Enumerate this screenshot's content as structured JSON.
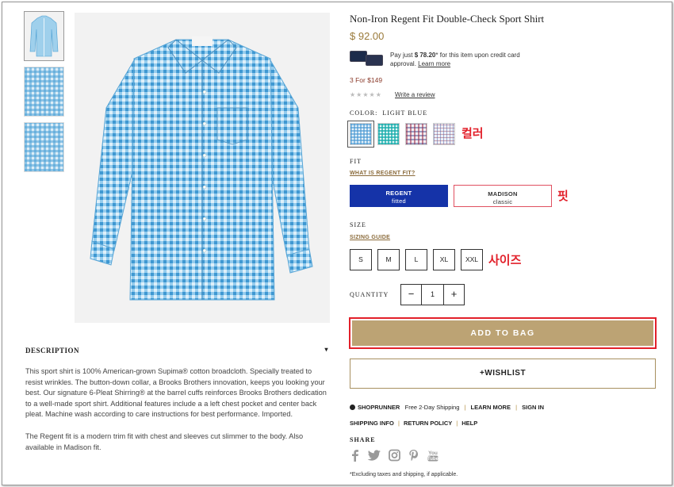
{
  "product": {
    "title": "Non-Iron Regent Fit Double-Check Sport Shirt",
    "price": "$ 92.00",
    "financing_text_1": "Pay just ",
    "financing_amount": "$ 78.20",
    "financing_text_2": "* for this item upon credit card approval. ",
    "financing_link": "Learn more",
    "promo": "3 For $149",
    "rating_stars": "★★★★★",
    "write_review": "Write a review"
  },
  "color": {
    "label": "COLOR:",
    "selected": "LIGHT BLUE",
    "annotation": "컬러"
  },
  "fit": {
    "label": "FIT",
    "guide_link": "WHAT IS REGENT FIT?",
    "options": [
      {
        "name": "REGENT",
        "sub": "fitted"
      },
      {
        "name": "MADISON",
        "sub": "classic"
      }
    ],
    "annotation": "핏"
  },
  "size": {
    "label": "SIZE",
    "guide_link": "SIZING GUIDE",
    "options": [
      "S",
      "M",
      "L",
      "XL",
      "XXL"
    ],
    "annotation": "사이즈"
  },
  "quantity": {
    "label": "QUANTITY",
    "value": "1",
    "minus": "−",
    "plus": "+"
  },
  "actions": {
    "add_to_bag": "ADD TO BAG",
    "wishlist": "+WISHLIST"
  },
  "shipping": {
    "shoprunner": "SHOPRUNNER",
    "free_shipping": "Free 2-Day Shipping",
    "learn_more": "LEARN MORE",
    "sign_in": "SIGN IN",
    "shipping_info": "SHIPPING INFO",
    "return_policy": "RETURN POLICY",
    "help": "HELP",
    "separator": "|"
  },
  "share": {
    "label": "SHARE",
    "icons": [
      "facebook-icon",
      "twitter-icon",
      "instagram-icon",
      "pinterest-icon",
      "youtube-icon"
    ]
  },
  "footnote": "*Excluding taxes and shipping, if applicable.",
  "description": {
    "heading": "DESCRIPTION",
    "toggle": "▾",
    "paragraph_1": "This sport shirt is 100% American-grown Supima® cotton broadcloth. Specially treated to resist wrinkles. The button-down collar, a Brooks Brothers innovation, keeps you looking your best. Our signature 6-Pleat Shirring® at the barrel cuffs reinforces Brooks Brothers dedication to a well-made sport shirt. Additional features include a a left chest pocket and center back pleat. Machine wash according to care instructions for best performance. Imported.",
    "paragraph_2": "The Regent fit is a modern trim fit with chest and sleeves cut slimmer to the body. Also available in Madison fit."
  },
  "colors": {
    "accent_gold": "#bca374",
    "regent_blue": "#1533a8",
    "annotation_red": "#e2202a"
  }
}
